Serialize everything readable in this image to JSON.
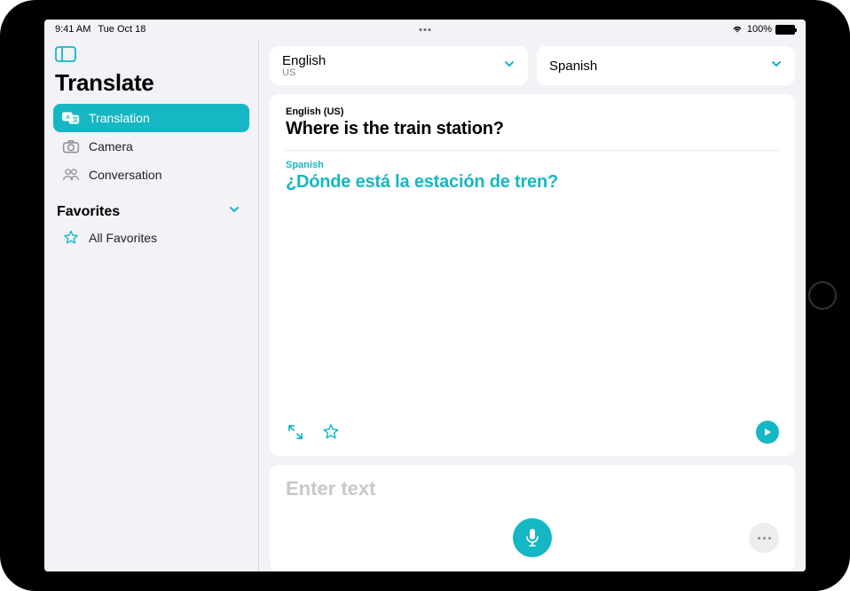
{
  "status": {
    "time": "9:41 AM",
    "date": "Tue Oct 18",
    "battery": "100%"
  },
  "sidebar": {
    "title": "Translate",
    "items": [
      {
        "label": "Translation"
      },
      {
        "label": "Camera"
      },
      {
        "label": "Conversation"
      }
    ],
    "favorites_header": "Favorites",
    "favorites": [
      {
        "label": "All Favorites"
      }
    ]
  },
  "languages": {
    "source": {
      "name": "English",
      "region": "US"
    },
    "target": {
      "name": "Spanish",
      "region": ""
    }
  },
  "translation": {
    "source_label": "English (US)",
    "source_text": "Where is the train station?",
    "target_label": "Spanish",
    "target_text": "¿Dónde está la estación de tren?"
  },
  "input": {
    "placeholder": "Enter text"
  }
}
